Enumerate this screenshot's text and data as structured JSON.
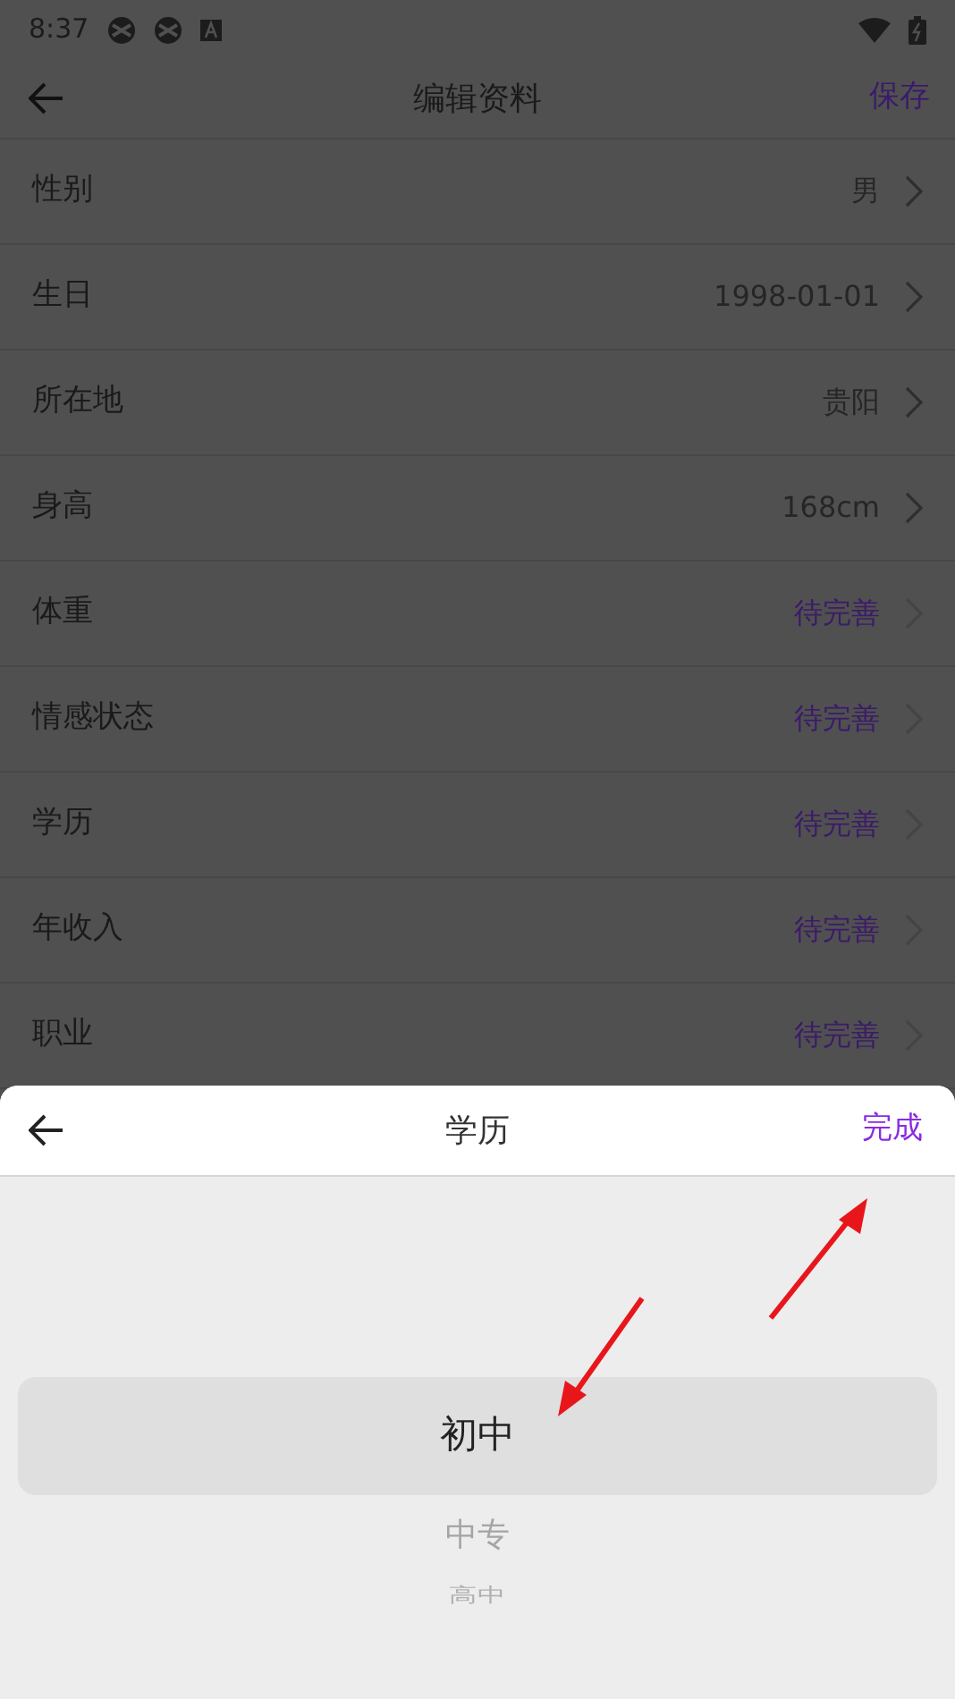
{
  "status_bar": {
    "time": "8:37"
  },
  "header": {
    "title": "编辑资料",
    "save": "保存"
  },
  "fields": [
    {
      "label": "性别",
      "value": "男",
      "filled": true
    },
    {
      "label": "生日",
      "value": "1998-01-01",
      "filled": true
    },
    {
      "label": "所在地",
      "value": "贵阳",
      "filled": true
    },
    {
      "label": "身高",
      "value": "168cm",
      "filled": true
    },
    {
      "label": "体重",
      "value": "待完善",
      "filled": false
    },
    {
      "label": "情感状态",
      "value": "待完善",
      "filled": false
    },
    {
      "label": "学历",
      "value": "待完善",
      "filled": false
    },
    {
      "label": "年收入",
      "value": "待完善",
      "filled": false
    },
    {
      "label": "职业",
      "value": "待完善",
      "filled": false
    }
  ],
  "picker": {
    "title": "学历",
    "done": "完成",
    "options": [
      {
        "label": "初中",
        "selected": true
      },
      {
        "label": "中专",
        "selected": false
      },
      {
        "label": "高中",
        "selected": false
      }
    ]
  }
}
